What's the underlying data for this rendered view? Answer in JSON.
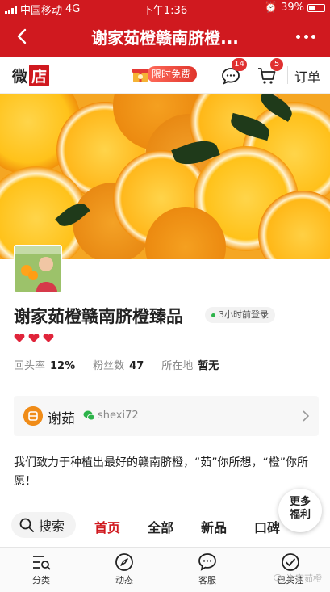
{
  "status_bar": {
    "carrier": "中国移动",
    "network": "4G",
    "time": "下午1:36",
    "battery": "39%"
  },
  "title_bar": {
    "title": "谢家茹橙赣南脐橙..."
  },
  "header": {
    "logo_text": "微",
    "logo_box_text": "店",
    "promo_label": "限时免费",
    "message_count": "14",
    "cart_count": "5",
    "orders_label": "订单"
  },
  "shop": {
    "name": "谢家茹橙赣南脐橙臻品",
    "last_login": "3小时前登录",
    "rating_hearts": 3,
    "stats": [
      {
        "label": "回头率",
        "value": "12%"
      },
      {
        "label": "粉丝数",
        "value": "47"
      },
      {
        "label": "所在地",
        "value": "暂无"
      }
    ]
  },
  "owner": {
    "name": "谢茹",
    "wechat": "shexi72"
  },
  "description": "我们致力于种植出最好的赣南脐橙，“茹”你所想，“橙”你所愿！",
  "floating": {
    "line1": "更多",
    "line2": "福利"
  },
  "tabs": {
    "search_label": "搜索",
    "items": [
      "首页",
      "全部",
      "新品",
      "口碑"
    ],
    "active": "首页"
  },
  "bottom_nav": [
    {
      "label": "分类",
      "icon": "category-icon"
    },
    {
      "label": "动态",
      "icon": "compass-icon"
    },
    {
      "label": "客服",
      "icon": "chat-icon"
    },
    {
      "label": "已关注",
      "icon": "check-circle-icon"
    }
  ],
  "watermark": "谢家茹橙",
  "colors": {
    "brand_red": "#d0191f",
    "accent_orange": "#f08c18",
    "online_green": "#2db34a"
  }
}
